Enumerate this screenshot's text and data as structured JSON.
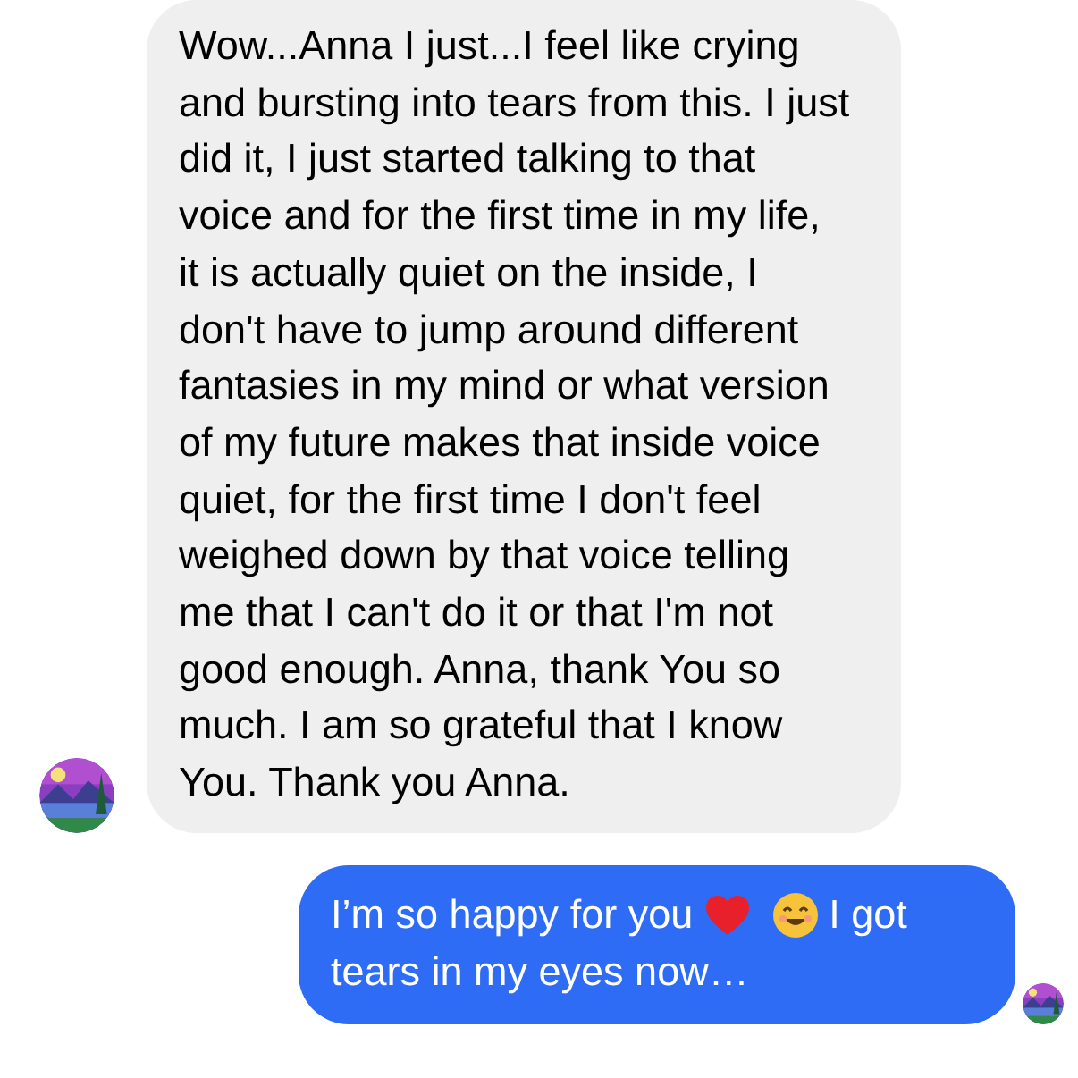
{
  "messages": [
    {
      "kind": "received",
      "text": "Wow...Anna I just...I feel like crying and bursting into tears from this. I just did it, I just started talking to that voice and for the first time in my life, it is actually quiet on the inside, I don't have to jump around different fantasies in my mind or what version of my future makes that inside voice quiet, for the first time I don't feel weighed down by that voice telling me that I can't do it or that I'm not good enough. Anna, thank You so much. I am so grateful that I know You. Thank you Anna."
    },
    {
      "kind": "sent",
      "text_before": "I’m so happy for you",
      "text_after": [
        "I got",
        "tears in my eyes now…"
      ]
    }
  ]
}
